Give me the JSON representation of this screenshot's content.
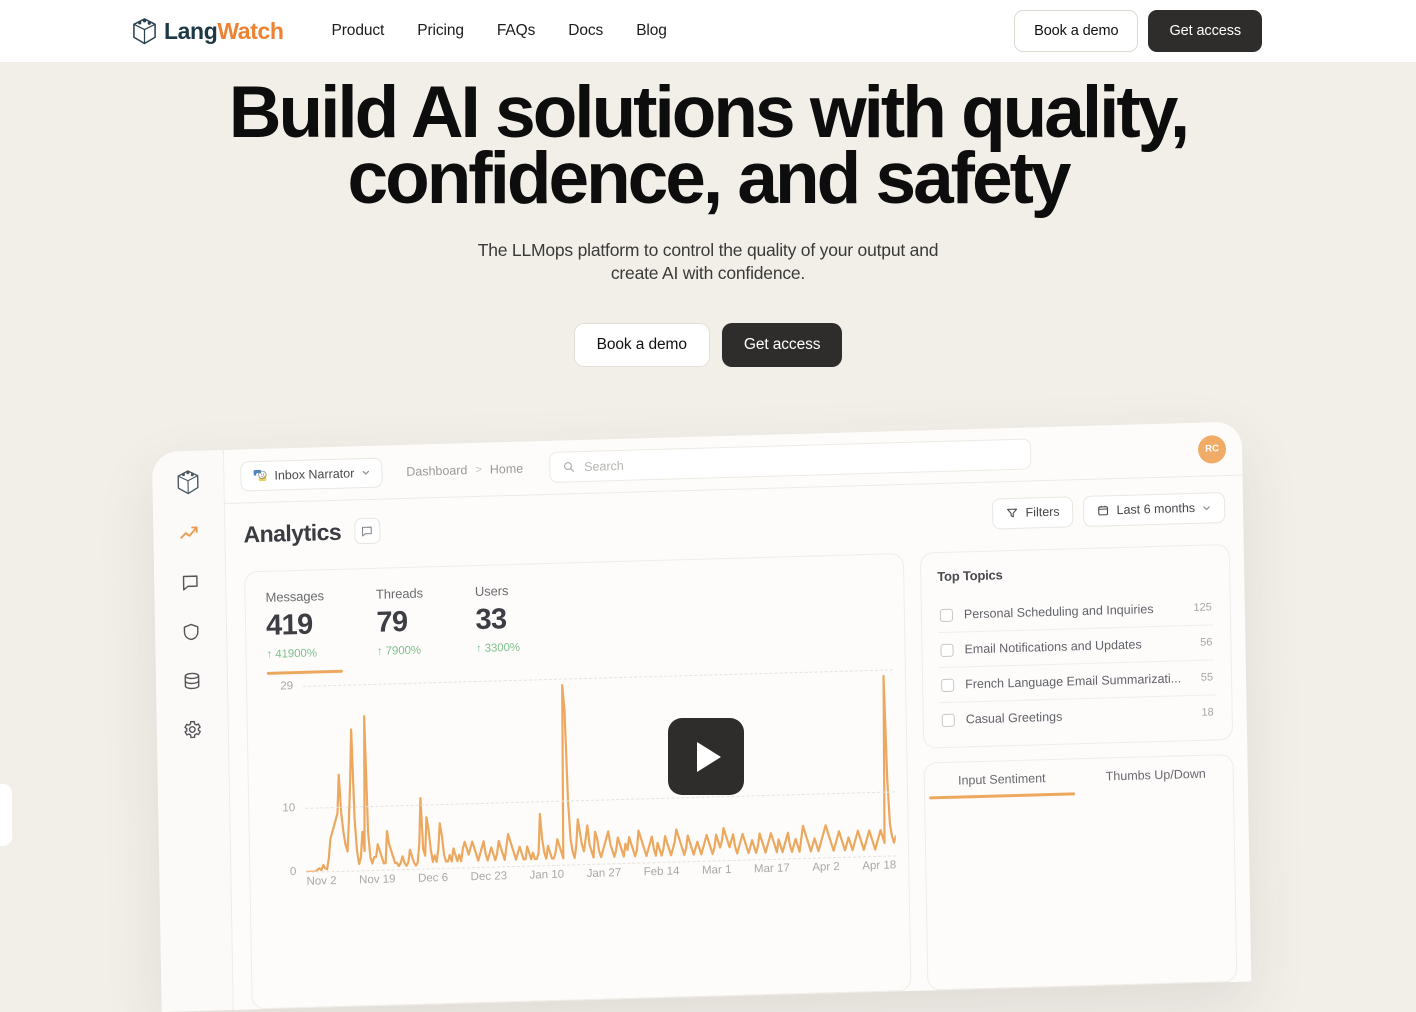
{
  "nav": {
    "logo": {
      "part1": "Lang",
      "part2": "Watch",
      "icon": "cube-logo-icon"
    },
    "links": [
      {
        "label": "Product"
      },
      {
        "label": "Pricing"
      },
      {
        "label": "FAQs"
      },
      {
        "label": "Docs"
      },
      {
        "label": "Blog"
      }
    ],
    "book_demo": "Book a demo",
    "get_access": "Get access"
  },
  "hero": {
    "title_line1": "Build AI solutions with quality,",
    "title_line2": "confidence, and safety",
    "subtitle_line1": "The LLMops platform to control the quality of your output and",
    "subtitle_line2": "create AI with confidence.",
    "book_demo": "Book a demo",
    "get_access": "Get access"
  },
  "dashboard": {
    "sidebar": [
      {
        "name": "logo",
        "icon": "cube-logo-icon",
        "active": false
      },
      {
        "name": "analytics",
        "icon": "trending-up-icon",
        "active": true
      },
      {
        "name": "messages",
        "icon": "chat-bubble-icon",
        "active": false
      },
      {
        "name": "guardrails",
        "icon": "shield-icon",
        "active": false
      },
      {
        "name": "datasets",
        "icon": "database-icon",
        "active": false
      },
      {
        "name": "settings",
        "icon": "gear-icon",
        "active": false
      }
    ],
    "project": {
      "name": "Inbox Narrator",
      "icon": "python-brain-icon"
    },
    "breadcrumb": [
      "Dashboard",
      "Home"
    ],
    "breadcrumb_separator": ">",
    "search_placeholder": "Search",
    "avatar_initials": "RC",
    "page_title": "Analytics",
    "note_icon": "comment-icon",
    "filters_label": "Filters",
    "filters_icon": "funnel-icon",
    "date_range_label": "Last 6 months",
    "date_range_icon": "calendar-icon",
    "metrics": [
      {
        "label": "Messages",
        "value": "419",
        "delta": "↑ 41900%",
        "active": true
      },
      {
        "label": "Threads",
        "value": "79",
        "delta": "↑ 7900%",
        "active": false
      },
      {
        "label": "Users",
        "value": "33",
        "delta": "↑ 3300%",
        "active": false
      }
    ],
    "top_topics": {
      "title": "Top Topics",
      "items": [
        {
          "label": "Personal Scheduling and Inquiries",
          "count": "125"
        },
        {
          "label": "Email Notifications and Updates",
          "count": "56"
        },
        {
          "label": "French Language Email Summarizati...",
          "count": "55"
        },
        {
          "label": "Casual Greetings",
          "count": "18"
        }
      ]
    },
    "sentiment_tabs": [
      {
        "label": "Input Sentiment",
        "active": true
      },
      {
        "label": "Thumbs Up/Down",
        "active": false
      }
    ],
    "play_button": "play-icon"
  },
  "chart_data": {
    "type": "line",
    "title": "Messages over time",
    "xlabel": "",
    "ylabel": "",
    "ylim": [
      0,
      29
    ],
    "yticks": [
      "0",
      "10",
      "29"
    ],
    "grid": true,
    "legend": "none",
    "color": "#eda85f",
    "xticks": [
      "Nov 2",
      "Nov 19",
      "Dec 6",
      "Dec 23",
      "Jan 10",
      "Jan 27",
      "Feb 14",
      "Mar 1",
      "Mar 17",
      "Apr 2",
      "Apr 18"
    ],
    "series": [
      {
        "name": "Messages",
        "values": [
          0,
          0,
          0,
          0,
          0,
          0,
          0.3,
          0.5,
          0.2,
          1,
          0.5,
          0.3,
          2,
          5,
          6,
          7,
          8,
          9,
          15,
          9,
          6,
          4,
          3,
          8,
          14,
          22,
          8,
          3,
          1,
          2,
          6,
          3,
          24,
          6,
          2,
          1,
          2,
          2,
          4,
          3,
          2,
          1,
          1,
          6,
          4,
          3,
          2,
          1,
          1,
          0.5,
          1,
          2,
          1,
          0.5,
          1,
          3,
          2,
          1,
          0.5,
          1,
          4,
          11,
          3,
          2,
          8,
          6,
          3,
          1,
          2,
          1,
          3,
          7,
          5,
          2,
          1,
          1,
          2,
          1,
          3,
          2,
          1,
          2,
          1,
          3,
          4,
          3,
          2,
          3,
          4,
          3,
          2,
          1,
          2,
          3,
          4,
          2,
          1,
          2,
          3,
          2,
          1,
          2,
          4,
          3,
          2,
          1,
          3,
          5,
          4,
          3,
          2,
          1,
          2,
          3,
          2,
          1,
          1,
          3,
          2,
          1,
          2,
          1,
          1,
          2,
          8,
          4,
          2,
          1,
          3,
          2,
          1,
          1,
          2,
          4,
          3,
          2,
          1,
          28,
          24,
          10,
          4,
          2,
          1,
          3,
          7,
          5,
          3,
          2,
          4,
          6,
          3,
          2,
          1,
          5,
          4,
          2,
          1,
          2,
          3,
          4,
          5,
          3,
          2,
          1,
          2,
          4,
          3,
          2,
          1,
          3,
          2,
          4,
          3,
          2,
          1,
          2,
          5,
          4,
          3,
          2,
          1,
          2,
          3,
          4,
          2,
          1,
          3,
          2,
          1,
          2,
          4,
          3,
          2,
          1,
          2,
          3,
          5,
          4,
          3,
          2,
          1,
          2,
          4,
          3,
          2,
          1,
          2,
          3,
          2,
          1,
          2,
          3,
          4,
          3,
          2,
          1,
          2,
          4,
          3,
          2,
          3,
          5,
          4,
          3,
          2,
          3,
          4,
          2,
          1,
          2,
          3,
          4,
          3,
          2,
          1,
          2,
          3,
          2,
          1,
          2,
          4,
          3,
          2,
          1,
          2,
          3,
          4,
          3,
          2,
          1,
          3,
          2,
          1,
          2,
          3,
          4,
          2,
          1,
          2,
          3,
          2,
          1,
          3,
          5,
          4,
          3,
          2,
          1,
          2,
          3,
          2,
          1,
          2,
          3,
          4,
          5,
          4,
          3,
          2,
          1,
          2,
          3,
          4,
          3,
          2,
          1,
          2,
          3,
          2,
          1,
          2,
          3,
          4,
          3,
          2,
          1,
          2,
          3,
          4,
          3,
          2,
          1,
          2,
          3,
          4,
          3,
          2,
          28,
          12,
          5,
          3,
          2,
          3
        ]
      }
    ]
  }
}
